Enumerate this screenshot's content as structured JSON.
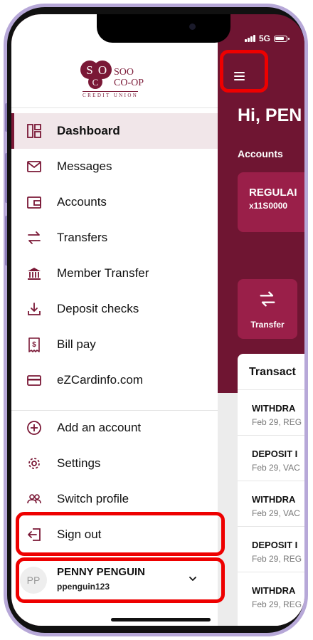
{
  "status": {
    "network": "5G"
  },
  "drawer": {
    "logo": {
      "line1": "SOO",
      "line2": "CO-OP",
      "subtitle": "CREDIT UNION"
    },
    "nav": [
      {
        "label": "Dashboard",
        "icon": "dashboard-icon",
        "active": true
      },
      {
        "label": "Messages",
        "icon": "envelope-icon"
      },
      {
        "label": "Accounts",
        "icon": "wallet-icon"
      },
      {
        "label": "Transfers",
        "icon": "transfer-arrows-icon"
      },
      {
        "label": "Member Transfer",
        "icon": "bank-icon"
      },
      {
        "label": "Deposit checks",
        "icon": "download-icon"
      },
      {
        "label": "Bill pay",
        "icon": "receipt-icon"
      },
      {
        "label": "eZCardinfo.com",
        "icon": "credit-card-icon"
      }
    ],
    "secondary": [
      {
        "label": "Add an account",
        "icon": "plus-circle-icon"
      },
      {
        "label": "Settings",
        "icon": "gear-icon"
      },
      {
        "label": "Switch profile",
        "icon": "users-icon"
      },
      {
        "label": "Sign out",
        "icon": "sign-out-icon"
      }
    ],
    "profile": {
      "initials": "PP",
      "name": "PENNY PENGUIN",
      "username": "ppenguin123"
    }
  },
  "background": {
    "greeting": "Hi, PEN",
    "accounts_label": "Accounts",
    "account": {
      "name": "REGULAI",
      "number": "x11S0000"
    },
    "transfer_label": "Transfer",
    "transactions_title": "Transact",
    "transactions": [
      {
        "title": "WITHDRA",
        "date": "Feb 29, REG"
      },
      {
        "title": "DEPOSIT I",
        "date": "Feb 29, VAC"
      },
      {
        "title": "WITHDRA",
        "date": "Feb 29, VAC"
      },
      {
        "title": "DEPOSIT I",
        "date": "Feb 29, REG"
      },
      {
        "title": "WITHDRA",
        "date": "Feb 29, REG"
      }
    ]
  },
  "colors": {
    "brand": "#7a1836",
    "header_bg": "#6f1532",
    "card": "#9a1f49",
    "highlight": "#ee0000"
  }
}
